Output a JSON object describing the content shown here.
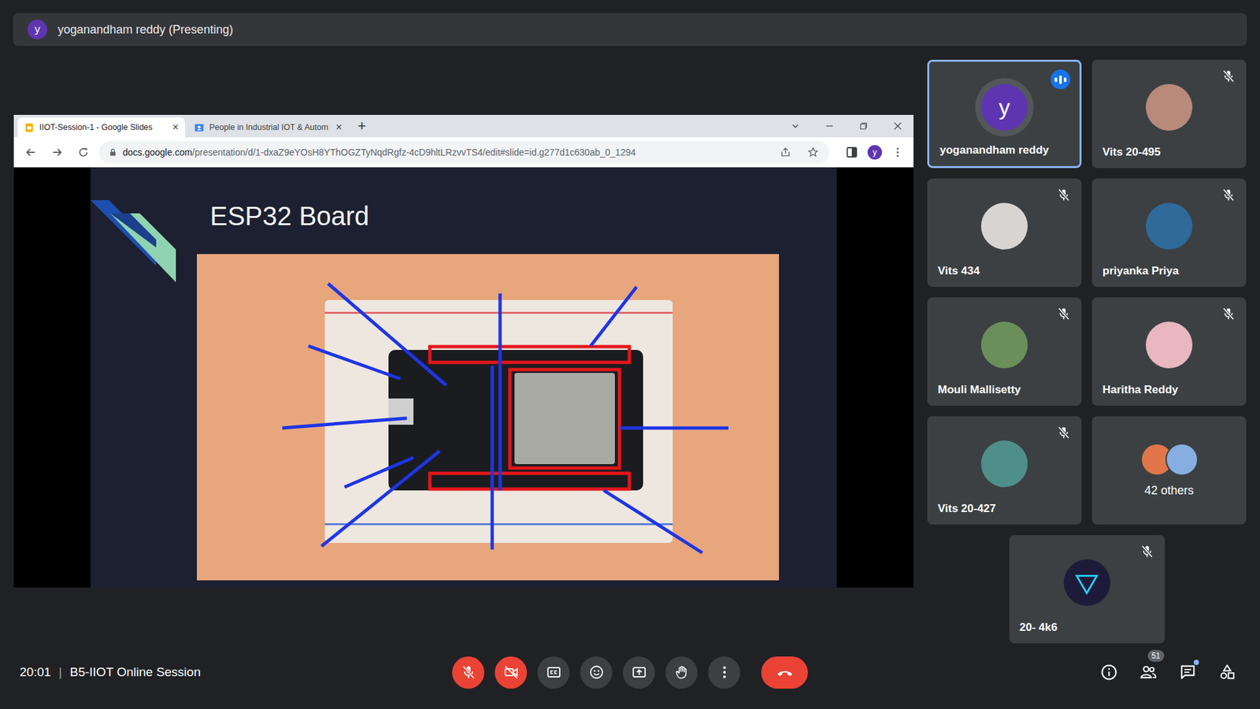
{
  "meeting": {
    "banner": "yoganandham reddy (Presenting)",
    "banner_initial": "y",
    "time": "20:01",
    "separator": "|",
    "title": "B5-IIOT Online Session"
  },
  "browser": {
    "tabs": [
      {
        "label": "IIOT-Session-1 - Google Slides",
        "selected": true,
        "close": "×"
      },
      {
        "label": "People in Industrial IOT & Autom",
        "selected": false,
        "close": "×"
      }
    ],
    "new_tab": "+",
    "url_host": "docs.google.com",
    "url_path": "/presentation/d/1-dxaZ9eYOsH8YThOGZTyNqdRgfz-4cD9hltLRzvvTS4/edit#slide=id.g277d1c630ab_0_1294",
    "profile_initial": "y"
  },
  "slide": {
    "title": "ESP32 Board"
  },
  "participants": [
    {
      "name": "yoganandham reddy",
      "kind": "initial",
      "initial": "y",
      "color": "#5e35b1",
      "muted": false,
      "speaking": true,
      "selected": true
    },
    {
      "name": "Vits 20-495",
      "kind": "photo",
      "color": "#b88a7a",
      "muted": true,
      "speaking": false,
      "selected": false
    },
    {
      "name": "Vits 434",
      "kind": "photo",
      "color": "#d8d4d2",
      "muted": true,
      "speaking": false,
      "selected": false
    },
    {
      "name": "priyanka Priya",
      "kind": "photo",
      "color": "#2f6a9a",
      "muted": true,
      "speaking": false,
      "selected": false
    },
    {
      "name": "Mouli Mallisetty",
      "kind": "photo",
      "color": "#6b8f5a",
      "muted": true,
      "speaking": false,
      "selected": false
    },
    {
      "name": "Haritha Reddy",
      "kind": "photo",
      "color": "#e8b7c0",
      "muted": true,
      "speaking": false,
      "selected": false
    },
    {
      "name": "Vits 20-427",
      "kind": "photo",
      "color": "#4f8f8a",
      "muted": true,
      "speaking": false,
      "selected": false
    },
    {
      "name": "20- 4k6",
      "kind": "photo",
      "color": "#1e1b3a",
      "muted": true,
      "speaking": false,
      "selected": false
    }
  ],
  "others": {
    "label": "42 others",
    "colors": [
      "#e0764a",
      "#86aee0"
    ]
  },
  "controls": [
    {
      "kind": "mic",
      "off": true
    },
    {
      "kind": "camera",
      "off": true
    },
    {
      "kind": "captions",
      "off": false
    },
    {
      "kind": "emoji",
      "off": false
    },
    {
      "kind": "present",
      "off": false
    },
    {
      "kind": "hand",
      "off": false
    },
    {
      "kind": "more",
      "off": false
    },
    {
      "kind": "leave",
      "off": false
    }
  ],
  "side_controls": [
    {
      "kind": "info"
    },
    {
      "kind": "people",
      "badge": "51"
    },
    {
      "kind": "chat",
      "unread": true
    },
    {
      "kind": "activities"
    }
  ]
}
